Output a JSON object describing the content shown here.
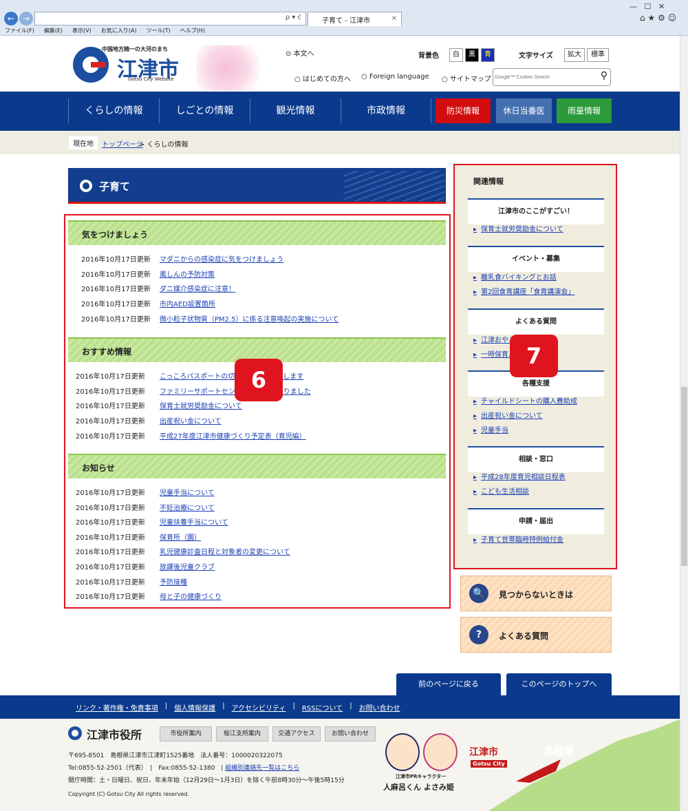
{
  "browser": {
    "tab_title": "子育て - 江津市",
    "menu": [
      "ファイル(F)",
      "編集(E)",
      "表示(V)",
      "お気に入り(A)",
      "ツール(T)",
      "ヘルプ(H)"
    ],
    "search_hint": "ρ ▾ ċ"
  },
  "header": {
    "tagline": "中国地方随一の大河のまち",
    "site_name": "江津市",
    "site_en": "Gotsu City Website",
    "skip": "本文へ",
    "bg_label": "背景色",
    "bg_options": [
      "白",
      "黒",
      "青"
    ],
    "font_label": "文字サイズ",
    "font_options": [
      "拡大",
      "標準"
    ],
    "links": [
      "はじめての方へ",
      "Foreign language",
      "サイトマップ"
    ],
    "search_placeholder": "Google™ Custom Search"
  },
  "nav": {
    "items": [
      "くらしの情報",
      "しごとの情報",
      "観光情報",
      "市政情報"
    ],
    "special": [
      "防災情報",
      "休日当番医",
      "雨量情報"
    ]
  },
  "breadcrumb": {
    "label": "現在地",
    "top": "トップページ",
    "current": "くらしの情報"
  },
  "page_title": "子育て",
  "sections": [
    {
      "title": "気をつけましょう",
      "rows": [
        {
          "date": "2016年10月17日更新",
          "text": "マダニからの感染症に気をつけましょう"
        },
        {
          "date": "2016年10月17日更新",
          "text": "風しんの予防対策"
        },
        {
          "date": "2016年10月17日更新",
          "text": "ダニ媒介感染症に注意！"
        },
        {
          "date": "2016年10月17日更新",
          "text": "市内AED設置箇所"
        },
        {
          "date": "2016年10月17日更新",
          "text": "微小粒子状物質（PM2.5）に係る注意喚起の実施について"
        }
      ]
    },
    {
      "title": "おすすめ情報",
      "rows": [
        {
          "date": "2016年10月17日更新",
          "text": "こっころパスポートの切り替えをお願いします"
        },
        {
          "date": "2016年10月17日更新",
          "text": "ファミリーサポートセンター事業が始まりました"
        },
        {
          "date": "2016年10月17日更新",
          "text": "保育士就労奨励金について"
        },
        {
          "date": "2016年10月17日更新",
          "text": "出産祝い金について"
        },
        {
          "date": "2016年10月17日更新",
          "text": "平成27年度江津市健康づくり予定表（育児編）"
        }
      ]
    },
    {
      "title": "お知らせ",
      "rows": [
        {
          "date": "2016年10月17日更新",
          "text": "児童手当について"
        },
        {
          "date": "2016年10月17日更新",
          "text": "不妊治療について"
        },
        {
          "date": "2016年10月17日更新",
          "text": "児童扶養手当について"
        },
        {
          "date": "2016年10月17日更新",
          "text": "保育所（園）"
        },
        {
          "date": "2016年10月17日更新",
          "text": "乳児健康診査日程と対象者の変更について"
        },
        {
          "date": "2016年10月17日更新",
          "text": "放課後児童クラブ"
        },
        {
          "date": "2016年10月17日更新",
          "text": "予防接種"
        },
        {
          "date": "2016年10月17日更新",
          "text": "母と子の健康づくり"
        }
      ]
    }
  ],
  "annotations": {
    "main": "6",
    "side": "7"
  },
  "sidebar": {
    "title": "関連情報",
    "groups": [
      {
        "head": "江津市のここがすごい！",
        "links": [
          "保育士就労奨励金について"
        ]
      },
      {
        "head": "イベント・募集",
        "links": [
          "離乳食バイキングとお話",
          "第2回食育講座「食育講演会」"
        ]
      },
      {
        "head": "よくある質問",
        "links": [
          "江津おやこ…の方法",
          "一時保育…"
        ]
      },
      {
        "head": "各種支援",
        "links": [
          "チャイルドシートの購入費助成",
          "出産祝い金について",
          "児童手当"
        ]
      },
      {
        "head": "相談・窓口",
        "links": [
          "平成28年度育児相談日程表",
          "こども生活相談"
        ]
      },
      {
        "head": "申請・届出",
        "links": [
          "子育て世帯臨時特例給付金"
        ]
      }
    ]
  },
  "help": {
    "not_found": "見つからないときは",
    "faq": "よくある質問"
  },
  "pager": {
    "back": "前のページに戻る",
    "top": "このページのトップへ"
  },
  "footer": {
    "links": [
      "リンク・著作権・免責事項",
      "個人情報保護",
      "アクセシビリティ",
      "RSSについて",
      "お問い合わせ"
    ],
    "office": "江津市役所",
    "buttons": [
      "市役所案内",
      "桜江支所案内",
      "交通アクセス",
      "お問い合わせ"
    ],
    "address": "〒695-8501　島根県江津市江津町1525番地　法人番号：1000020322075",
    "tel": "Tel:0855-52-2501（代表）　|　Fax:0855-52-1380　|",
    "tel_link": "組織別連絡先一覧はこちら",
    "hours": "開庁時間：土・日曜日、祝日、年末年始（12月29日～1月3日）を除く午前8時30分～午後5時15分",
    "copyright": "Copyright (C) Gotsu City All rights reserved.",
    "mascot_caption": "江津市PRキャラクター",
    "mascot_names": "人麻呂くん よさみ姫",
    "map_city": "江津市",
    "map_city_en": "Gotsu City",
    "map_pref": "島根県"
  }
}
